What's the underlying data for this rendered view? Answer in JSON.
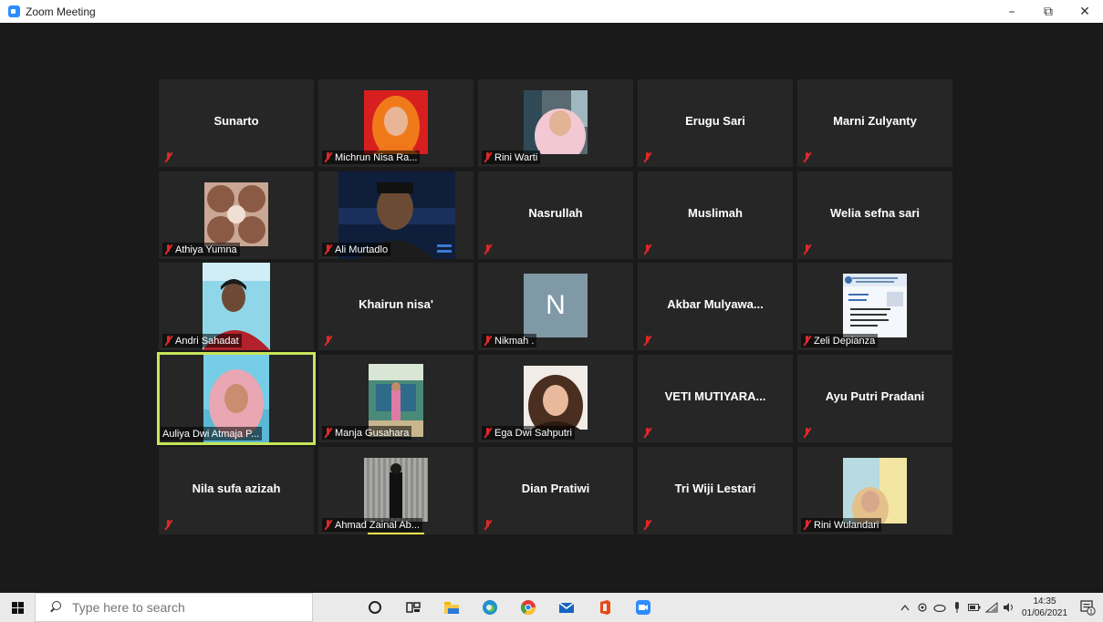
{
  "window": {
    "title": "Zoom Meeting",
    "controls": {
      "minimize": "–",
      "restore": "⧉",
      "close": "✕"
    }
  },
  "participants": [
    {
      "name": "Sunarto",
      "video": false
    },
    {
      "name": "Michrun Nisa Ra...",
      "video": true
    },
    {
      "name": "Rini Warti",
      "video": true
    },
    {
      "name": "Erugu Sari",
      "video": false
    },
    {
      "name": "Marni Zulyanty",
      "video": false
    },
    {
      "name": "Athiya Yumna",
      "video": true
    },
    {
      "name": "Ali Murtadlo",
      "video": true
    },
    {
      "name": "Nasrullah",
      "video": false
    },
    {
      "name": "Muslimah",
      "video": false
    },
    {
      "name": "Welia sefna sari",
      "video": false
    },
    {
      "name": "Andri Sahadat",
      "video": true
    },
    {
      "name": "Khairun nisa'",
      "video": false
    },
    {
      "name": "Nikmah .",
      "video": false,
      "avatar_letter": "N"
    },
    {
      "name": "Akbar  Mulyawa...",
      "video": false
    },
    {
      "name": "Zeli Depianza",
      "video": true
    },
    {
      "name": "Auliya Dwi Atmaja P...",
      "video": true,
      "active_speaker": true
    },
    {
      "name": "Manja Gusahara",
      "video": true
    },
    {
      "name": "Ega Dwi Sahputri",
      "video": true
    },
    {
      "name": "VETI MUTIYARA...",
      "video": false
    },
    {
      "name": "Ayu Putri Pradani",
      "video": false
    },
    {
      "name": "Nila sufa azizah",
      "video": false
    },
    {
      "name": "Ahmad Zainal Ab...",
      "video": true
    },
    {
      "name": "Dian Pratiwi",
      "video": false
    },
    {
      "name": "Tri Wiji Lestari",
      "video": false
    },
    {
      "name": "Rini Wulandari",
      "video": true
    }
  ],
  "taskbar": {
    "search_placeholder": "Type here to search",
    "pinned_icons": [
      "cortana-icon",
      "task-view-icon",
      "file-explorer-icon",
      "edge-icon",
      "chrome-icon",
      "mail-icon",
      "office-icon",
      "zoom-icon"
    ],
    "time": "14:35",
    "date": "01/06/2021",
    "notification_count": "1"
  },
  "colors": {
    "accent_zoom": "#2d8cff",
    "active_speaker": "#c8e55a",
    "muted_icon": "#e02828",
    "tile_bg": "#262626"
  }
}
